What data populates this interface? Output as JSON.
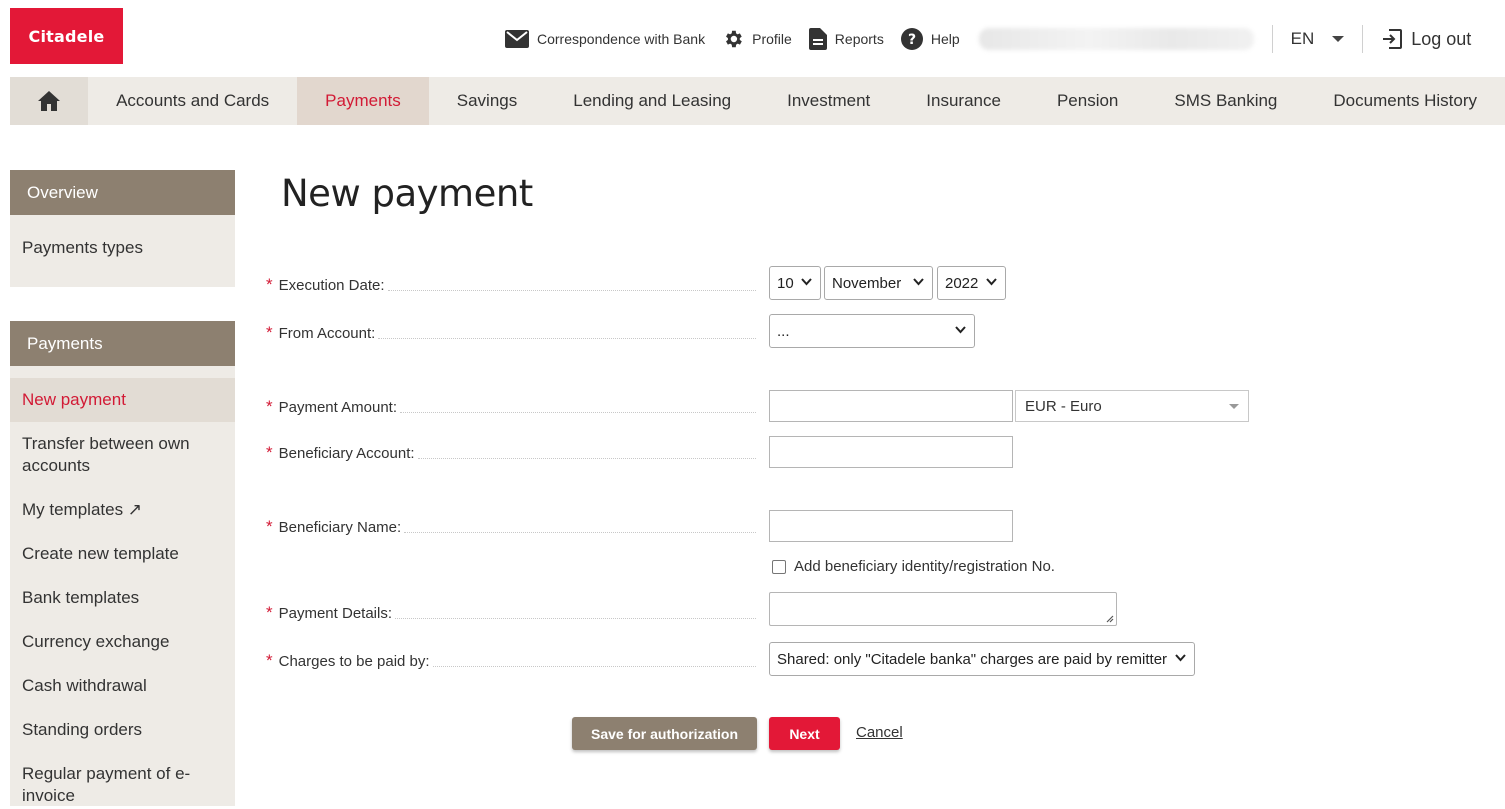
{
  "brand": {
    "logo_text": "Citadele",
    "color": "#e31837"
  },
  "header": {
    "links": [
      {
        "label": "Correspondence with Bank",
        "icon": "envelope-icon"
      },
      {
        "label": "Profile",
        "icon": "gear-icon"
      },
      {
        "label": "Reports",
        "icon": "document-icon"
      },
      {
        "label": "Help",
        "icon": "help-icon"
      }
    ],
    "language": "EN",
    "logout_label": "Log out"
  },
  "nav": {
    "home_icon": "home-icon",
    "items": [
      "Accounts and Cards",
      "Payments",
      "Savings",
      "Lending and Leasing",
      "Investment",
      "Insurance",
      "Pension",
      "SMS Banking",
      "Documents History"
    ],
    "active": "Payments"
  },
  "sidebar": {
    "overview_title": "Overview",
    "overview_items": [
      "Payments types"
    ],
    "payments_title": "Payments",
    "payments_items": [
      "New payment",
      "Transfer between own accounts",
      "My templates ↗",
      "Create new template",
      "Bank templates",
      "Currency exchange",
      "Cash withdrawal",
      "Standing orders",
      "Regular payment of e-invoice"
    ],
    "active_item": "New payment"
  },
  "form": {
    "title": "New payment",
    "execution_date": {
      "label": "Execution Date:",
      "day": "10",
      "month": "November",
      "year": "2022"
    },
    "from_account": {
      "label": "From Account:",
      "value": "..."
    },
    "payment_amount": {
      "label": "Payment Amount:",
      "value": "",
      "currency": "EUR - Euro"
    },
    "beneficiary_account": {
      "label": "Beneficiary Account:",
      "value": ""
    },
    "beneficiary_name": {
      "label": "Beneficiary Name:",
      "value": ""
    },
    "add_identity": {
      "label": "Add beneficiary identity/registration No.",
      "checked": false
    },
    "payment_details": {
      "label": "Payment Details:",
      "value": ""
    },
    "charges": {
      "label": "Charges to be paid by:",
      "value": "Shared: only \"Citadele banka\" charges are paid by remitter"
    },
    "required_marker": "*"
  },
  "actions": {
    "save_label": "Save for authorization",
    "next_label": "Next",
    "cancel_label": "Cancel"
  },
  "colors": {
    "accent_red": "#e31837",
    "sidebar_head": "#8d8070",
    "nav_bg": "#eeebe6"
  }
}
